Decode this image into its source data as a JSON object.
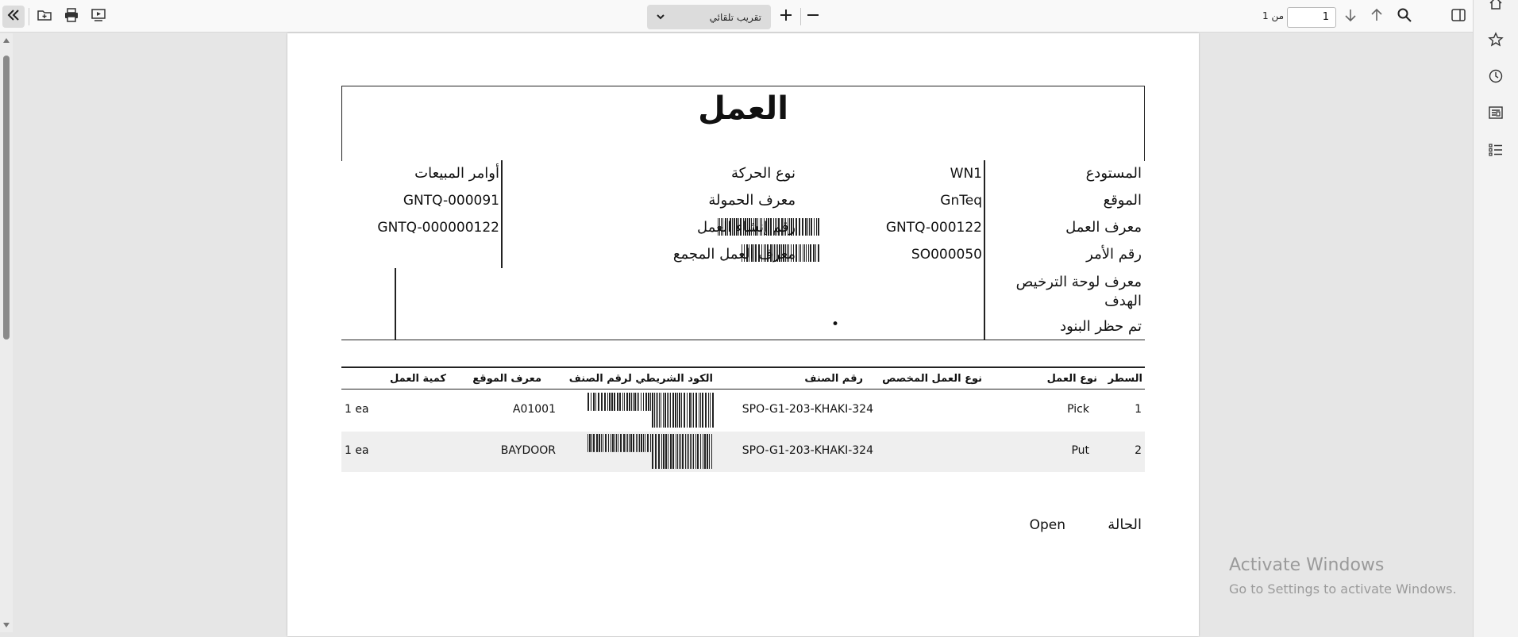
{
  "toolbar": {
    "zoom_value": "تقريب تلقائي",
    "page_number": "1",
    "page_of": "من 1"
  },
  "document": {
    "title": "العمل",
    "fields_right": {
      "warehouse_label": "المستودع",
      "warehouse_value": "WN1",
      "site_label": "الموقع",
      "site_value": "GnTeq",
      "work_id_label": "معرف العمل",
      "work_id_value": "GNTQ-000122",
      "order_number_label": "رقم الأمر",
      "order_number_value": "SO000050",
      "target_license_plate_label": "معرف لوحة الترخيص الهدف",
      "lines_blocked_label": "تم حظر البنود",
      "lines_blocked_value": "•"
    },
    "fields_left": {
      "transaction_type_label": "نوع الحركة",
      "transaction_type_value": "أوامر المبيعات",
      "load_id_label": "معرف الحمولة",
      "load_id_value": "GNTQ-000091",
      "work_creation_number_label": "رقم إنشاء العمل",
      "work_creation_number_value": "GNTQ-000000122",
      "cluster_id_label": "معرف العمل المجمع"
    },
    "table": {
      "headers": {
        "line": "السطر",
        "work_type": "نوع العمل",
        "custom_work_type": "نوع العمل المخصص",
        "item_number": "رقم الصنف",
        "item_barcode": "الكود الشريطي لرقم الصنف",
        "location_id": "معرف الموقع",
        "work_quantity": "كمية العمل"
      },
      "rows": [
        {
          "line": "1",
          "work_type": "Pick",
          "item_number": "SPO-G1-203-KHAKI-324",
          "location_id": "A01001",
          "work_quantity": "1 ea"
        },
        {
          "line": "2",
          "work_type": "Put",
          "item_number": "SPO-G1-203-KHAKI-324",
          "location_id": "BAYDOOR",
          "work_quantity": "1 ea"
        }
      ]
    },
    "status_label": "الحالة",
    "status_value": "Open"
  },
  "watermark": {
    "line1": "Activate Windows",
    "line2": "Go to Settings to activate Windows."
  },
  "icons": [
    "sidebar-toggle-icon",
    "open-file-icon",
    "print-icon",
    "presentation-icon",
    "zoom-in-icon",
    "zoom-out-icon",
    "search-icon",
    "arrow-up-icon",
    "arrow-down-icon",
    "reader-view-icon",
    "home-icon",
    "star-icon",
    "history-icon",
    "article-icon",
    "list-icon"
  ]
}
